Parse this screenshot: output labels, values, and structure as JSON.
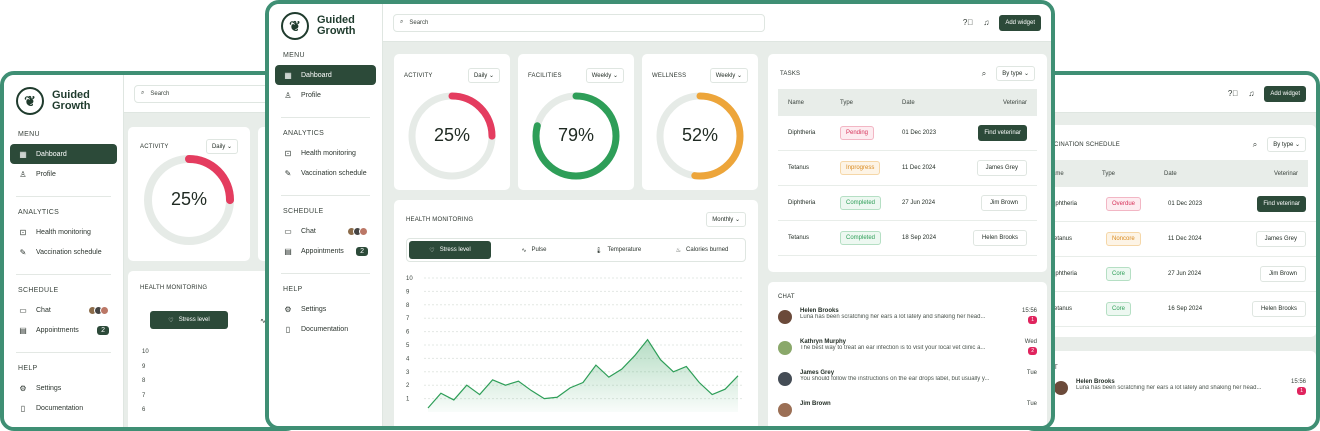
{
  "brand": {
    "line1": "Guided",
    "line2": "Growth"
  },
  "menu": {
    "section": "MENU",
    "dashboard": "Dahboard",
    "profile": "Profile"
  },
  "analytics": {
    "section": "ANALYTICS",
    "health": "Health monitoring",
    "vaccination": "Vaccination schedule"
  },
  "schedule": {
    "section": "SCHEDULE",
    "chat": "Chat",
    "appointments": "Appointments",
    "appointments_count": "2"
  },
  "help": {
    "section": "HELP",
    "settings": "Settings",
    "documentation": "Documentation"
  },
  "search": {
    "placeholder": "Search"
  },
  "toolbar": {
    "add_widget": "Add widget"
  },
  "gauges": [
    {
      "title": "ACTIVITY",
      "period": "Daily",
      "value_label": "25%",
      "value": 25,
      "color": "#e43c5f"
    },
    {
      "title": "FACILITIES",
      "period": "Weekly",
      "value_label": "79%",
      "value": 79,
      "color": "#2e9e58"
    },
    {
      "title": "WELLNESS",
      "period": "Weekly",
      "value_label": "52%",
      "value": 52,
      "color": "#eda53a"
    }
  ],
  "health": {
    "title": "HEALTH MONITORING",
    "period": "Monthly",
    "tabs": [
      "Stress level",
      "Pulse",
      "Temperature",
      "Calories burned"
    ]
  },
  "chart_data": {
    "type": "area",
    "y_ticks": [
      "10",
      "9",
      "8",
      "7",
      "6",
      "5",
      "4",
      "3",
      "2",
      "1"
    ],
    "ylim": [
      0,
      10
    ],
    "values": [
      0.3,
      1.4,
      0.9,
      2.0,
      1.3,
      2.4,
      2.0,
      2.3,
      1.6,
      1.0,
      1.1,
      1.8,
      2.2,
      3.5,
      2.6,
      3.2,
      4.2,
      5.4,
      3.9,
      3.0,
      3.4,
      2.2,
      1.3,
      1.7,
      2.7
    ],
    "color": "#2e9e58"
  },
  "tasks": {
    "title": "TASKS",
    "filter": "By type",
    "headers": [
      "Name",
      "Type",
      "Date",
      "Veterinar"
    ],
    "rows": [
      {
        "name": "Diphtheria",
        "type": "Pending",
        "date": "01 Dec 2023",
        "vet": "Find veterinar"
      },
      {
        "name": "Tetanus",
        "type": "Inprogress",
        "date": "11 Dec 2024",
        "vet": "James Grey"
      },
      {
        "name": "Diphtheria",
        "type": "Completed",
        "date": "27 Jun 2024",
        "vet": "Jim Brown"
      },
      {
        "name": "Tetanus",
        "type": "Completed",
        "date": "18 Sep 2024",
        "vet": "Helen Brooks"
      }
    ]
  },
  "vacc": {
    "title": "CINATION SCHEDULE",
    "filter": "By type",
    "headers": [
      "ame",
      "Type",
      "Date",
      "Veterinar"
    ],
    "rows": [
      {
        "name": "iphtheria",
        "type": "Overdue",
        "date": "01 Dec 2023",
        "vet": "Find veterinar"
      },
      {
        "name": "etanus",
        "type": "Noncore",
        "date": "11 Dec 2024",
        "vet": "James Grey"
      },
      {
        "name": "iphtheria",
        "type": "Core",
        "date": "27 Jun 2024",
        "vet": "Jim Brown"
      },
      {
        "name": "etanus",
        "type": "Core",
        "date": "16 Sep 2024",
        "vet": "Helen Brooks"
      }
    ]
  },
  "chat": {
    "title": "CHAT",
    "items": [
      {
        "name": "Helen Brooks",
        "time": "15:56",
        "msg": "Luna has been scratching her ears a lot lately and shaking her head...",
        "count": "1"
      },
      {
        "name": "Kathryn Murphy",
        "time": "Wed",
        "msg": "The best way to treat an ear infection is to visit your local vet clinic a...",
        "count": "2"
      },
      {
        "name": "James Grey",
        "time": "Tue",
        "msg": "You should follow the instructions on the ear drops label, but usually y...",
        "count": ""
      },
      {
        "name": "Jim Brown",
        "time": "Tue",
        "msg": "",
        "count": ""
      }
    ]
  },
  "rchat": {
    "title": "T",
    "name": "Helen Brooks",
    "time": "15:56",
    "msg": "Luna has been scratching her ears a lot lately and shaking her head...",
    "count": "1"
  }
}
